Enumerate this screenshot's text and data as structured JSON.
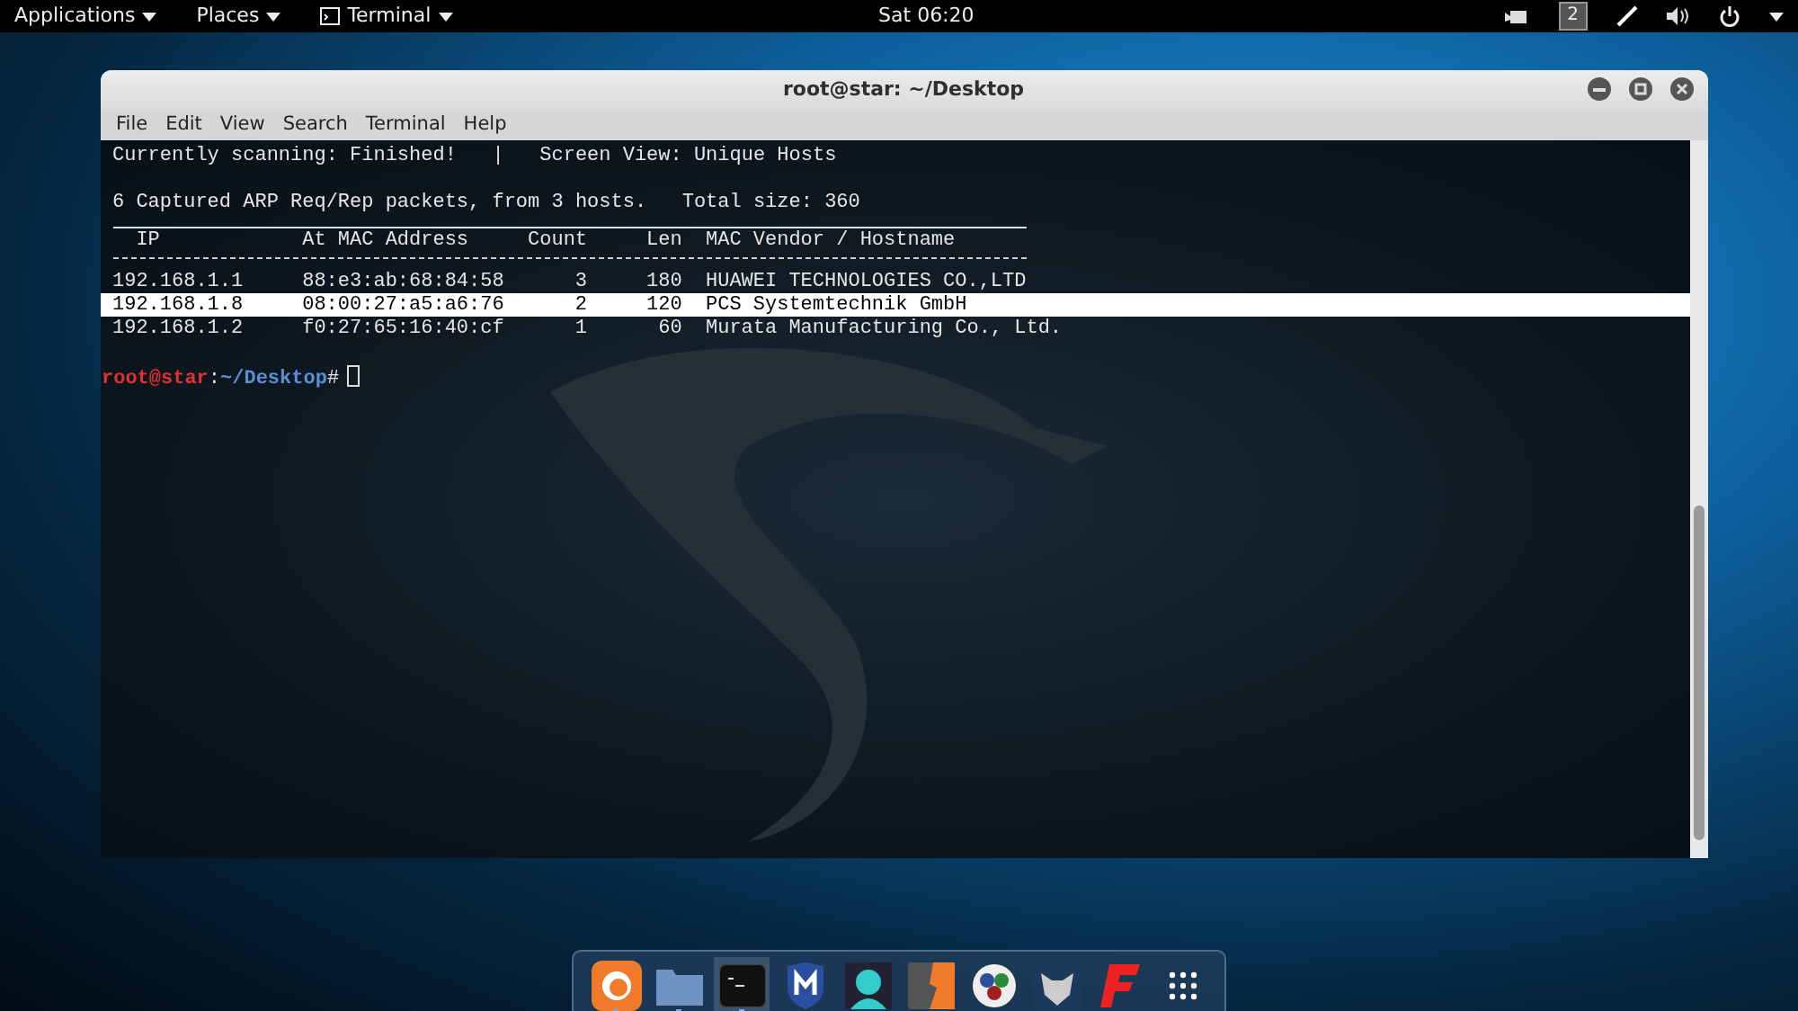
{
  "top_bar": {
    "menus": [
      {
        "label": "Applications",
        "kind": "text"
      },
      {
        "label": "Places",
        "kind": "text"
      },
      {
        "label": "Terminal",
        "kind": "app"
      }
    ],
    "clock": "Sat 06:20",
    "workspace": "2"
  },
  "window": {
    "title": "root@star: ~/Desktop",
    "menu": [
      "File",
      "Edit",
      "View",
      "Search",
      "Terminal",
      "Help"
    ],
    "terminal": {
      "status": "Currently scanning: Finished!   |   Screen View: Unique Hosts",
      "summary": "6 Captured ARP Req/Rep packets, from 3 hosts.   Total size: 360",
      "columns": [
        "IP",
        "At MAC Address",
        "Count",
        "Len",
        "MAC Vendor / Hostname"
      ],
      "rows": [
        {
          "ip": "192.168.1.1",
          "mac": "88:e3:ab:68:84:58",
          "count": "3",
          "len": "180",
          "vendor": "HUAWEI TECHNOLOGIES CO.,LTD",
          "selected": false
        },
        {
          "ip": "192.168.1.8",
          "mac": "08:00:27:a5:a6:76",
          "count": "2",
          "len": "120",
          "vendor": "PCS Systemtechnik GmbH",
          "selected": true
        },
        {
          "ip": "192.168.1.2",
          "mac": "f0:27:65:16:40:cf",
          "count": "1",
          "len": "60",
          "vendor": "Murata Manufacturing Co., Ltd.",
          "selected": false
        }
      ],
      "prompt": {
        "user": "root@star",
        "sep": ":",
        "path": "~/Desktop",
        "symbol": "#"
      }
    }
  },
  "dock": [
    {
      "kind": "fox",
      "running": true,
      "selected": false
    },
    {
      "kind": "folder",
      "running": true,
      "selected": false
    },
    {
      "kind": "terminal",
      "running": true,
      "selected": true
    },
    {
      "kind": "shield",
      "running": false,
      "selected": false
    },
    {
      "kind": "avatar",
      "running": false,
      "selected": false
    },
    {
      "kind": "bolt",
      "running": false,
      "selected": false
    },
    {
      "kind": "dots",
      "running": false,
      "selected": false
    },
    {
      "kind": "bull",
      "running": false,
      "selected": false
    },
    {
      "kind": "letter",
      "running": false,
      "selected": false
    },
    {
      "kind": "grid",
      "running": false,
      "selected": false
    }
  ]
}
